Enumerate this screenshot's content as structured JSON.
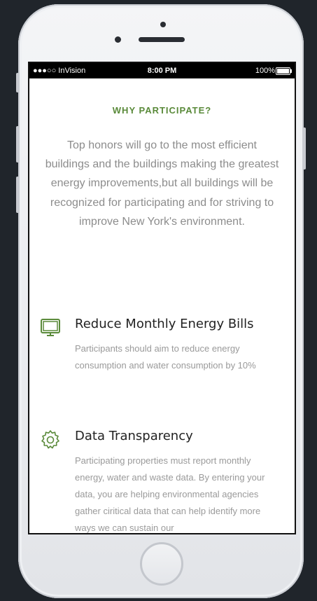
{
  "statusbar": {
    "carrier": "●●●○○ InVision",
    "time": "8:00 PM",
    "battery": "100%"
  },
  "section": {
    "heading": "WHY PARTICIPATE?",
    "intro": "Top honors will go to the most efficient buildings and the buildings making the greatest energy improvements,but all buildings will be recognized for participating and for striving to improve New York's environment."
  },
  "features": [
    {
      "icon": "monitor-icon",
      "title": "Reduce Monthly Energy Bills",
      "description": "Participants should aim to reduce energy consumption and water consumption by 10%"
    },
    {
      "icon": "gear-icon",
      "title": "Data Transparency",
      "description": "Participating properties must report monthly energy, water and waste data. By entering your data, you are helping environmental agencies gather ciritical data that can help identify more ways we can sustain our"
    }
  ],
  "colors": {
    "accent": "#5a8a3a",
    "text_muted": "#9a9a9a",
    "background": "#20252b"
  }
}
